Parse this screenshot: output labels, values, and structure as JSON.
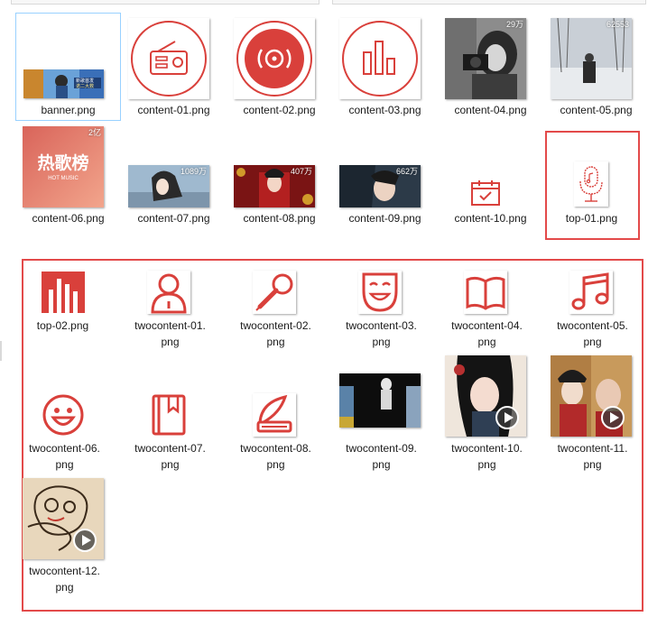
{
  "colors": {
    "accent_red": "#d9403b",
    "highlight_box": "#e34a4a",
    "selection_border": "#99d1ff"
  },
  "files": {
    "banner": {
      "name": "banner.png",
      "thumb_text_1": "新歌首发",
      "thumb_text_2": "诺二大救"
    },
    "content_01": {
      "name": "content-01.png",
      "icon": "radio-icon"
    },
    "content_02": {
      "name": "content-02.png",
      "icon": "vinyl-disc-icon"
    },
    "content_03": {
      "name": "content-03.png",
      "icon": "bar-chart-icon"
    },
    "content_04": {
      "name": "content-04.png",
      "plays": "29万"
    },
    "content_05": {
      "name": "content-05.png",
      "plays": "62553"
    },
    "content_06": {
      "name": "content-06.png",
      "plays": "2亿",
      "title_cn": "热歌榜",
      "subtitle": "HOT MUSIC"
    },
    "content_07": {
      "name": "content-07.png",
      "plays": "1089万"
    },
    "content_08": {
      "name": "content-08.png",
      "plays": "407万"
    },
    "content_09": {
      "name": "content-09.png",
      "plays": "662万"
    },
    "content_10": {
      "name": "content-10.png",
      "icon": "calendar-icon"
    },
    "top_01": {
      "name": "top-01.png",
      "icon": "microphone-icon"
    },
    "top_02": {
      "name": "top-02.png",
      "icon": "ranking-bars-icon"
    },
    "two_01": {
      "name_1": "twocontent-01.",
      "name_2": "png",
      "icon": "user-icon"
    },
    "two_02": {
      "name_1": "twocontent-02.",
      "name_2": "png",
      "icon": "karaoke-mic-icon"
    },
    "two_03": {
      "name_1": "twocontent-03.",
      "name_2": "png",
      "icon": "mask-icon"
    },
    "two_04": {
      "name_1": "twocontent-04.",
      "name_2": "png",
      "icon": "open-book-icon"
    },
    "two_05": {
      "name_1": "twocontent-05.",
      "name_2": "png",
      "icon": "music-note-icon"
    },
    "two_06": {
      "name_1": "twocontent-06.",
      "name_2": "png",
      "icon": "smiley-icon"
    },
    "two_07": {
      "name_1": "twocontent-07.",
      "name_2": "png",
      "icon": "bookmark-book-icon"
    },
    "two_08": {
      "name_1": "twocontent-08.",
      "name_2": "png",
      "icon": "quill-book-icon"
    },
    "two_09": {
      "name_1": "twocontent-09.",
      "name_2": "png"
    },
    "two_10": {
      "name_1": "twocontent-10.",
      "name_2": "png",
      "icon": "play-icon"
    },
    "two_11": {
      "name_1": "twocontent-11.",
      "name_2": "png",
      "icon": "play-icon"
    },
    "two_12": {
      "name_1": "twocontent-12.",
      "name_2": "png",
      "icon": "play-icon"
    }
  }
}
